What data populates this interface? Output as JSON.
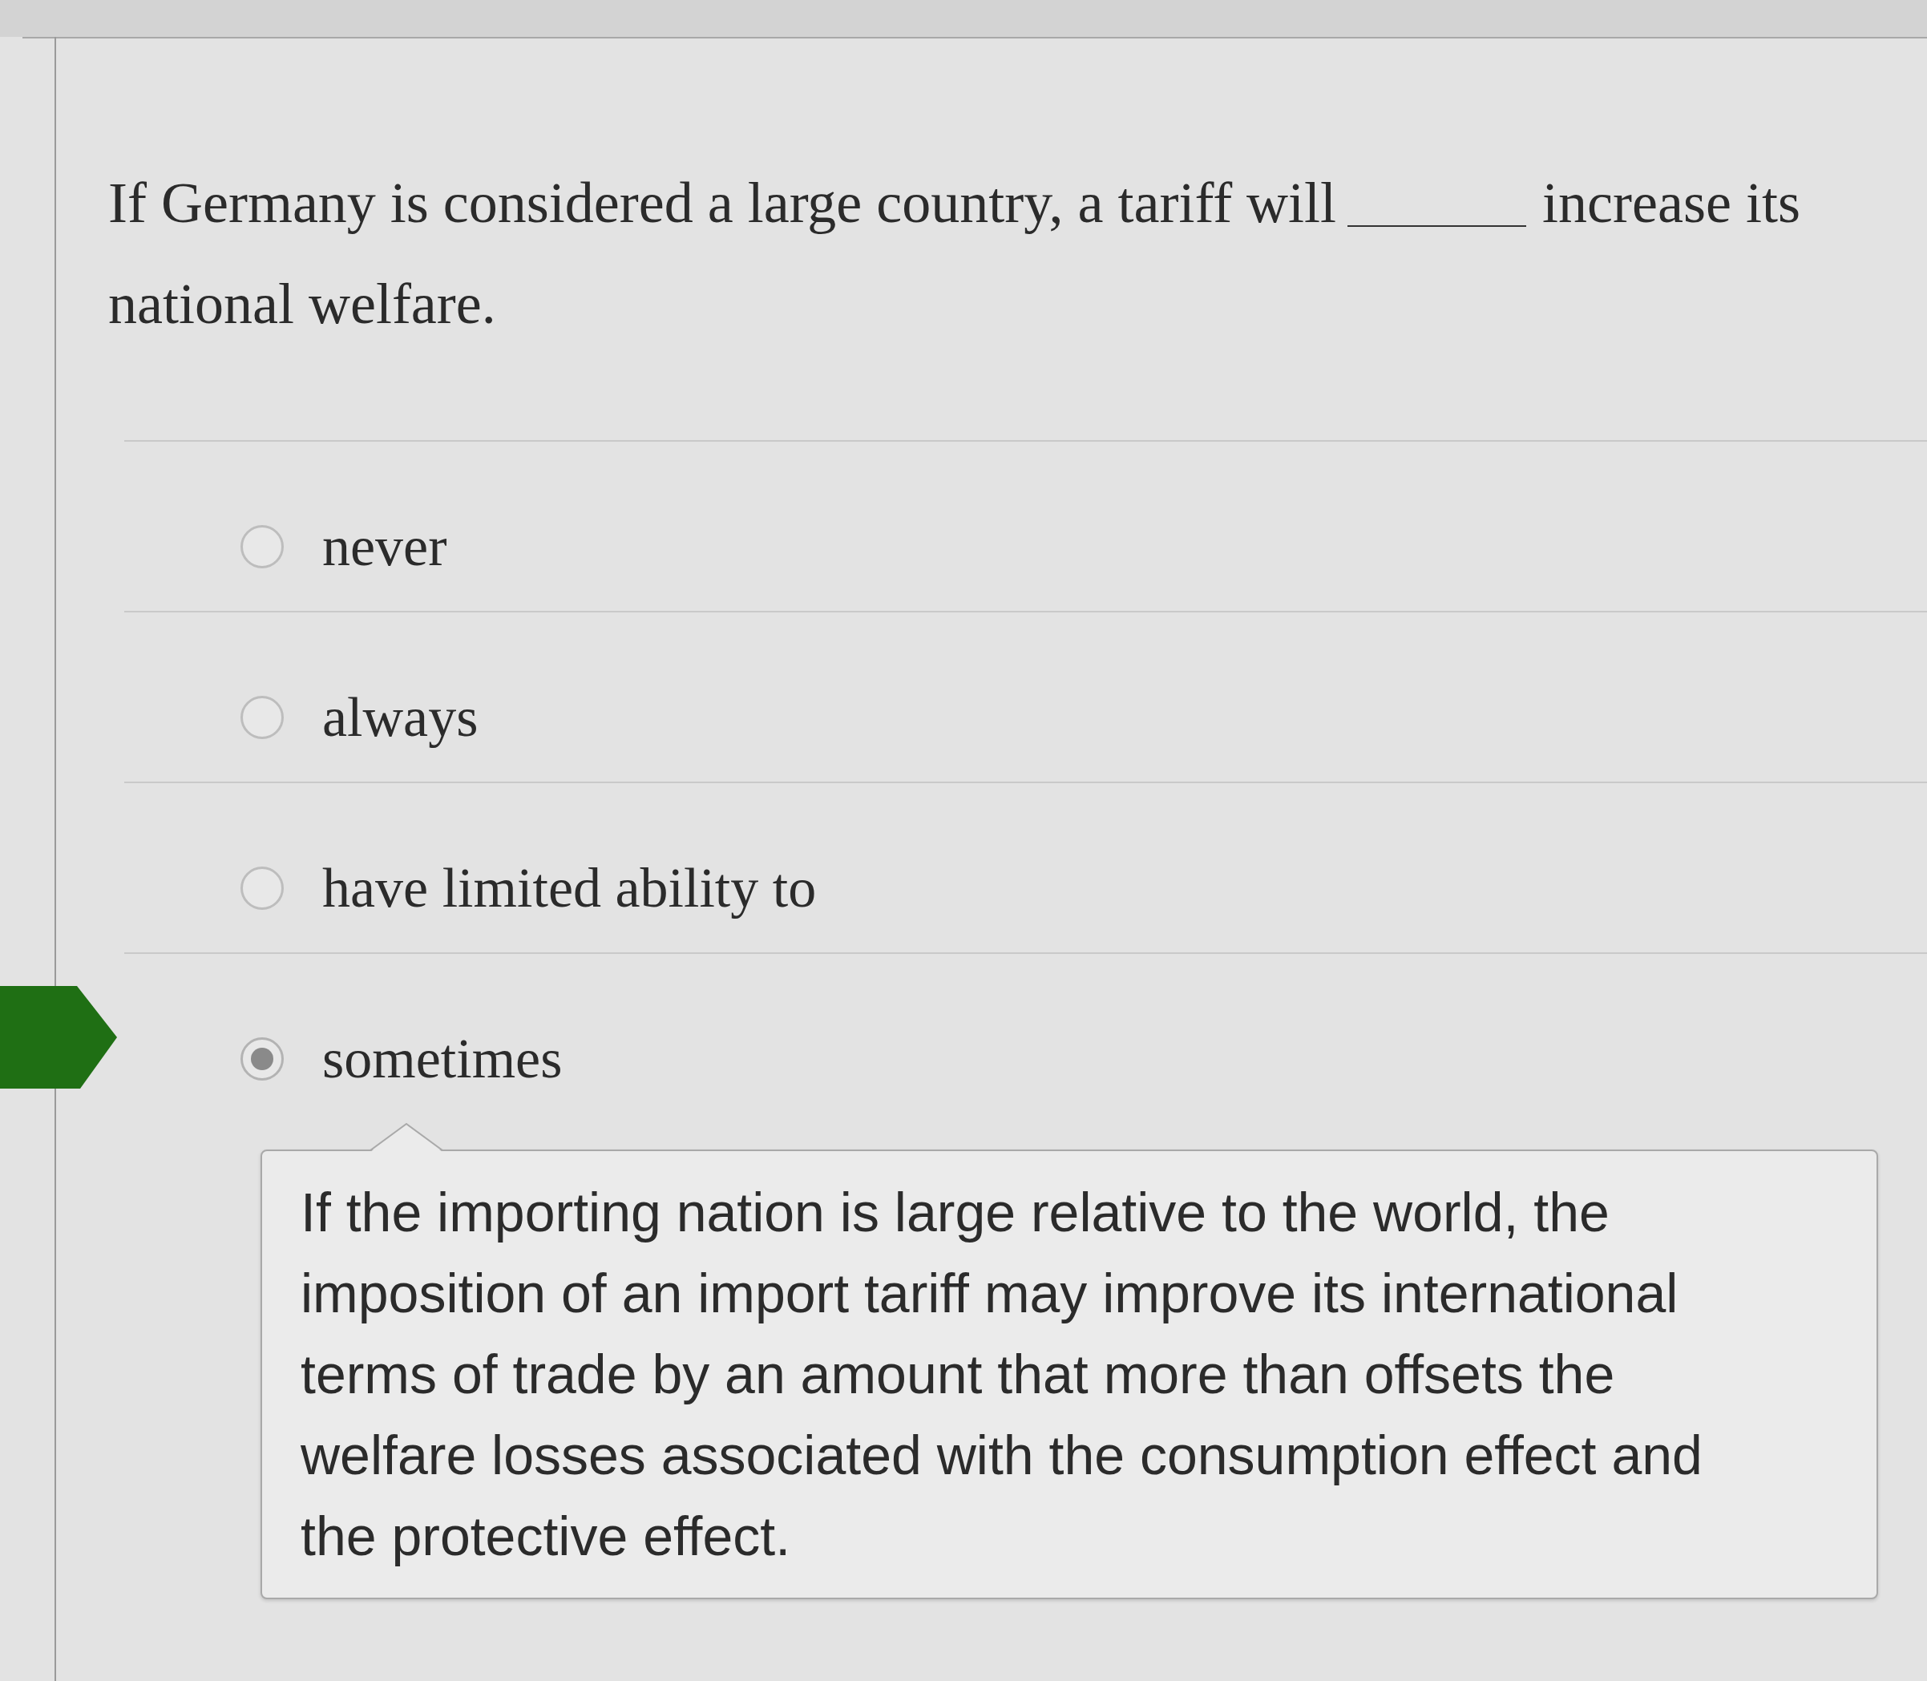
{
  "question": {
    "lines": [
      {
        "parts": [
          {
            "kind": "text",
            "text": "If Germany is considered a large country, a tariff will"
          },
          {
            "kind": "blank"
          },
          {
            "kind": "text",
            "text": "increase its"
          }
        ]
      },
      {
        "parts": [
          {
            "kind": "text",
            "text": "national welfare."
          }
        ]
      }
    ]
  },
  "options": [
    {
      "label": "never",
      "selected": false
    },
    {
      "label": "always",
      "selected": false
    },
    {
      "label": "have limited ability to",
      "selected": false
    },
    {
      "label": "sometimes",
      "selected": true
    }
  ],
  "feedback": {
    "text": "If the importing nation is large relative to the world, the imposition of an import tariff may improve its international terms of trade by an amount that more than offsets the welfare losses associated with the consumption effect and the protective effect."
  }
}
